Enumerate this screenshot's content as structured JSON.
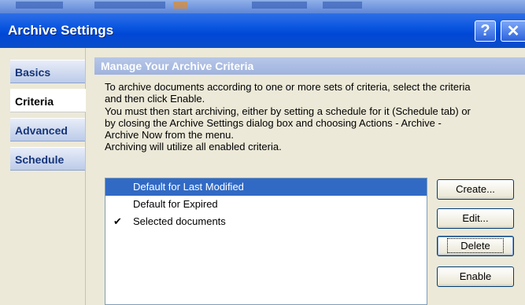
{
  "window": {
    "title": "Archive Settings",
    "help_button": "?",
    "close_button": "✕"
  },
  "nav": {
    "tabs": [
      {
        "label": "Basics",
        "active": false
      },
      {
        "label": "Criteria",
        "active": true
      },
      {
        "label": "Advanced",
        "active": false
      },
      {
        "label": "Schedule",
        "active": false
      }
    ]
  },
  "main": {
    "section_title": "Manage Your Archive Criteria",
    "description_lines": [
      "To archive documents according to one or more sets of criteria, select the criteria",
      "and then click Enable.",
      "You must then start archiving, either by setting a schedule for it (Schedule tab) or",
      "by closing the Archive Settings dialog box and choosing Actions - Archive -",
      "Archive Now from the menu.",
      "Archiving will utilize all enabled criteria."
    ],
    "criteria": [
      {
        "label": "Default for Last Modified",
        "selected": true,
        "enabled": false
      },
      {
        "label": "Default for Expired",
        "selected": false,
        "enabled": false
      },
      {
        "label": "Selected documents",
        "selected": false,
        "enabled": true,
        "check": "✔"
      }
    ],
    "buttons": {
      "create": "Create...",
      "edit": "Edit...",
      "delete": "Delete",
      "enable": "Enable"
    }
  },
  "colors": {
    "titlebar": "#0047d6",
    "selection": "#316ac5",
    "section_header": "#9fb3de"
  }
}
